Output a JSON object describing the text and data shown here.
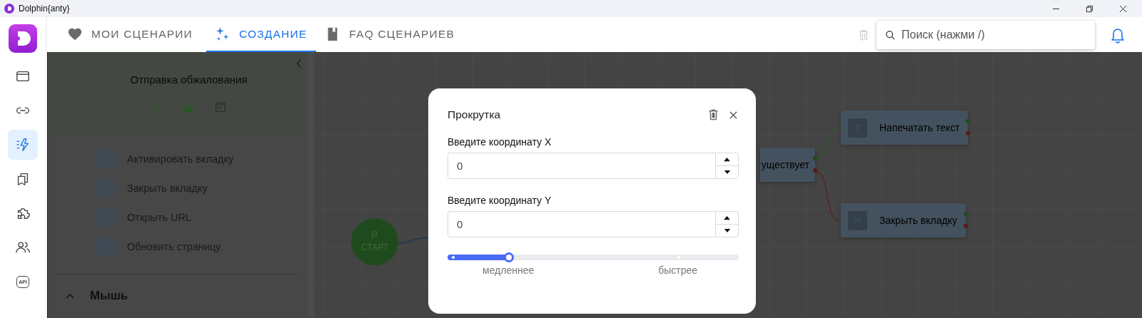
{
  "window": {
    "title": "Dolphin{anty}"
  },
  "nav_rail": [
    {
      "kind": "window",
      "selected": false
    },
    {
      "kind": "link",
      "selected": false
    },
    {
      "kind": "scenario",
      "selected": true
    },
    {
      "kind": "bookmarks",
      "selected": false
    },
    {
      "kind": "puzzle",
      "selected": false
    },
    {
      "kind": "users",
      "selected": false
    },
    {
      "kind": "api",
      "text": "API",
      "selected": false
    }
  ],
  "tabs": [
    {
      "kind": "heart",
      "label": "МОИ СЦЕНАРИИ",
      "selected": false
    },
    {
      "kind": "sparkle",
      "label": "СОЗДАНИЕ",
      "selected": true
    },
    {
      "kind": "book",
      "label": "FAQ СЦЕНАРИЕВ",
      "selected": false
    }
  ],
  "search": {
    "placeholder": "Поиск (нажми /)"
  },
  "panel": {
    "title": "Отправка обжалования",
    "items": [
      {
        "kind": "link",
        "label": "Активировать вкладку"
      },
      {
        "kind": "close",
        "label": "Закрыть вкладку"
      },
      {
        "kind": "url",
        "label": "Открыть URL"
      },
      {
        "kind": "refresh",
        "label": "Обновить страницу"
      }
    ],
    "section": {
      "label": "Мышь",
      "expanded": true
    }
  },
  "canvas": {
    "start": {
      "label": "СТАРТ"
    },
    "nodes": [
      {
        "kind": "partial",
        "label": "уществует"
      },
      {
        "kind": "text",
        "label": "Напечатать текст"
      },
      {
        "kind": "close",
        "label": "Закрыть вкладку"
      }
    ]
  },
  "modal": {
    "title": "Прокрутка",
    "fields": [
      {
        "label": "Введите координату X",
        "value": "0"
      },
      {
        "label": "Введите координату Y",
        "value": "0"
      }
    ],
    "slider": {
      "level": 0.21,
      "min_label": "медленнее",
      "max_label": "быстрее"
    }
  }
}
